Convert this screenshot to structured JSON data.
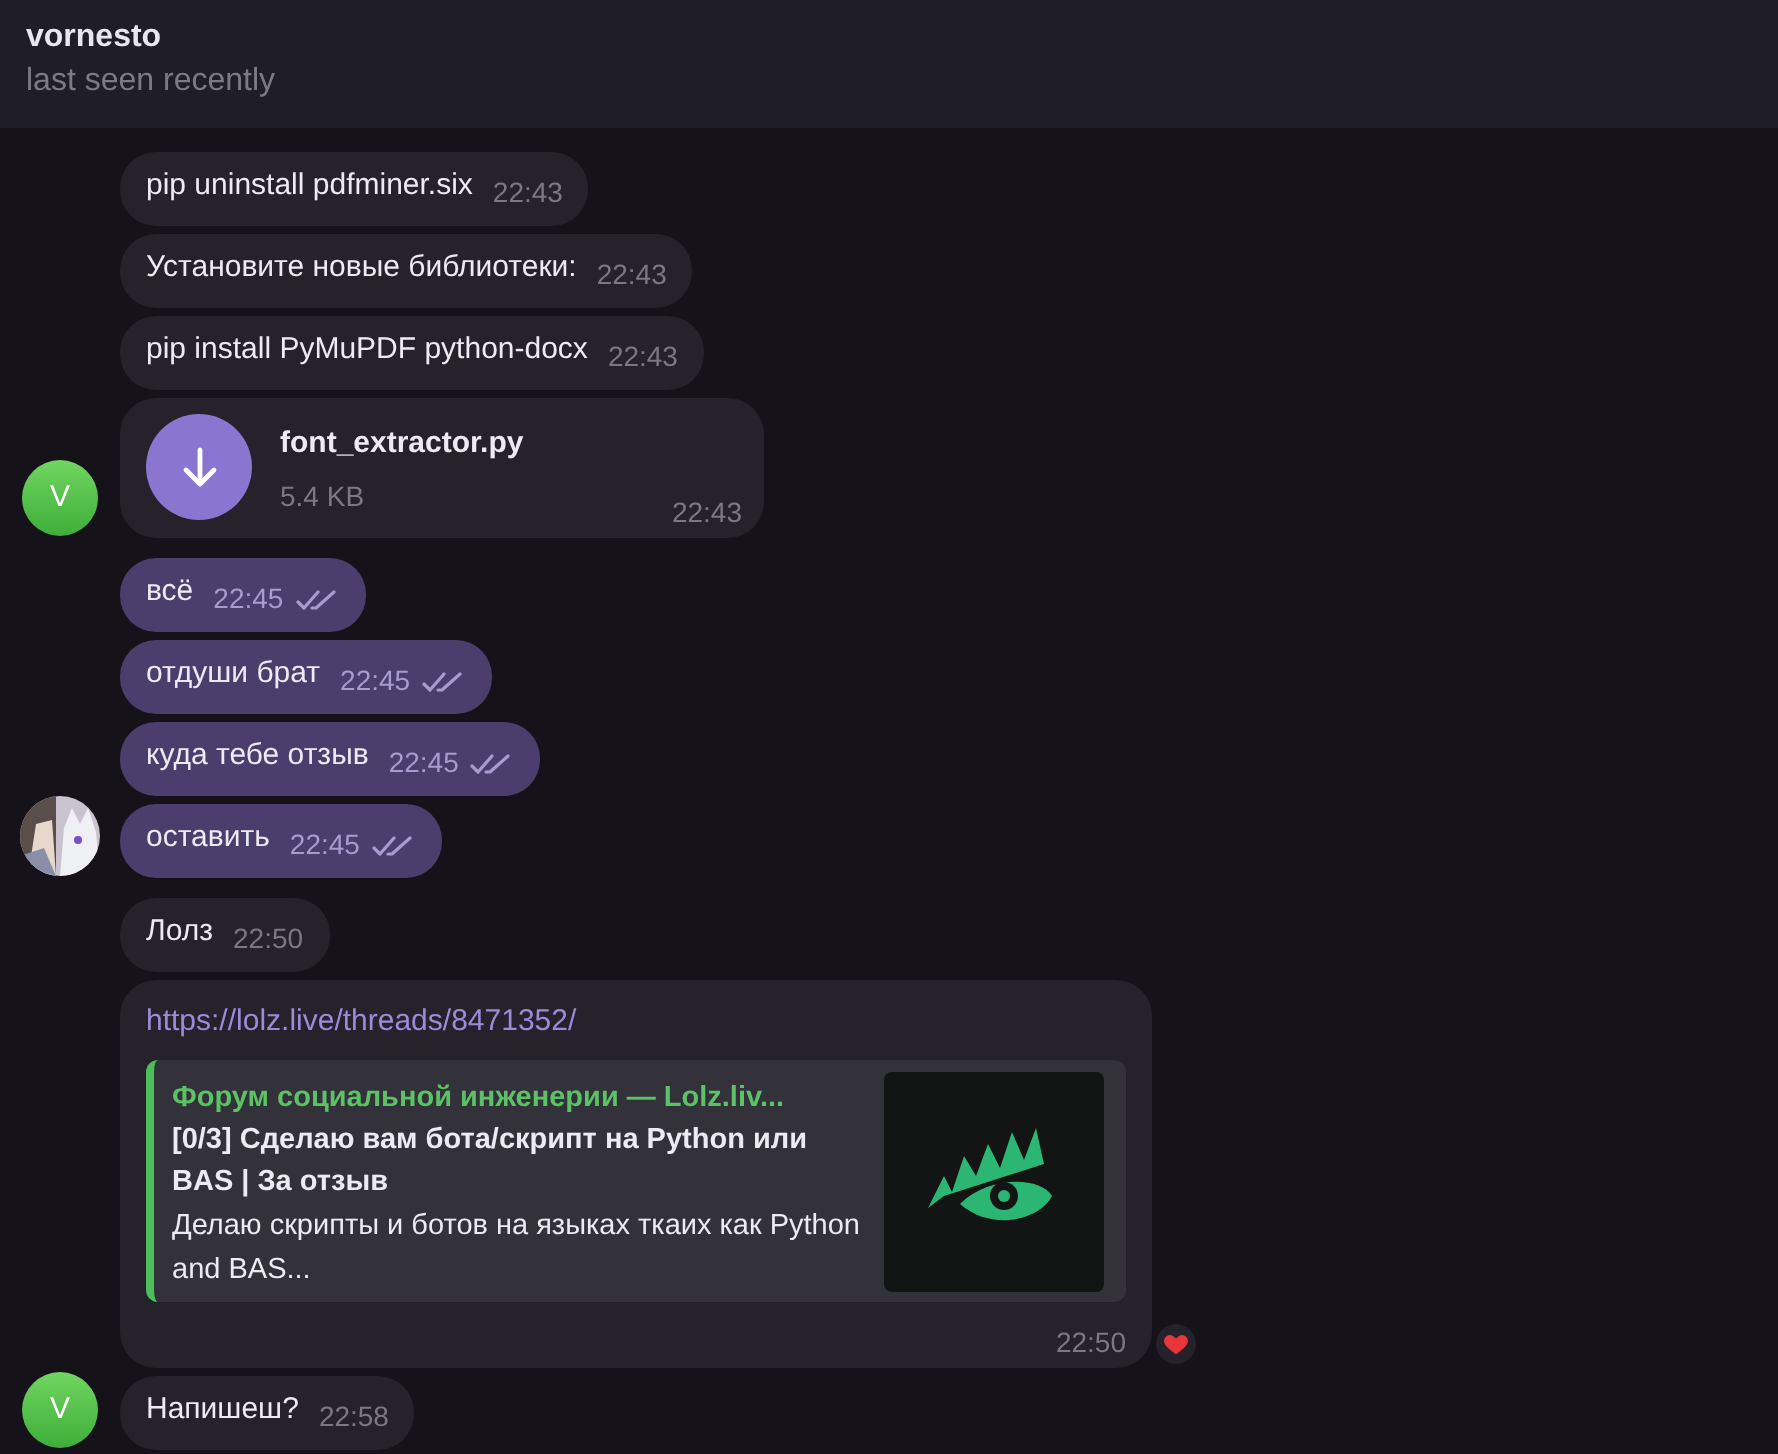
{
  "header": {
    "name": "vornesto",
    "status": "last seen recently"
  },
  "groups": [
    {
      "outgoing": false,
      "avatar": {
        "kind": "letter",
        "letter": "V"
      },
      "messages": [
        {
          "kind": "text",
          "text": "pip uninstall pdfminer.six",
          "time": "22:43"
        },
        {
          "kind": "text",
          "text": "Установите новые библиотеки:",
          "time": "22:43"
        },
        {
          "kind": "text",
          "text": "pip install PyMuPDF python-docx",
          "time": "22:43"
        },
        {
          "kind": "file",
          "filename": "font_extractor.py",
          "size": "5.4 KB",
          "time": "22:43"
        }
      ]
    },
    {
      "outgoing": true,
      "messages": [
        {
          "kind": "text",
          "text": "всё",
          "time": "22:45",
          "read": true
        },
        {
          "kind": "text",
          "text": "отдуши брат",
          "time": "22:45",
          "read": true
        },
        {
          "kind": "text",
          "text": "куда тебе отзыв",
          "time": "22:45",
          "read": true
        },
        {
          "kind": "text",
          "text": "оставить",
          "time": "22:45",
          "read": true
        }
      ]
    },
    {
      "outgoing": false,
      "avatar": {
        "kind": "letter",
        "letter": "V"
      },
      "messages": [
        {
          "kind": "text",
          "text": "Лолз",
          "time": "22:50"
        },
        {
          "kind": "link",
          "url": "https://lolz.live/threads/8471352/",
          "preview": {
            "site": "Форум социальной инженерии —  Lolz.liv...",
            "title": "[0/3] Сделаю вам бота/скрипт на Python или BAS | За отзыв",
            "description": "Делаю скрипты и ботов на языках ткаих как Python and BAS..."
          },
          "time": "22:50",
          "reaction": {
            "kind": "heart"
          }
        },
        {
          "kind": "text",
          "text": "Напишеш?",
          "time": "22:58"
        }
      ]
    }
  ]
}
